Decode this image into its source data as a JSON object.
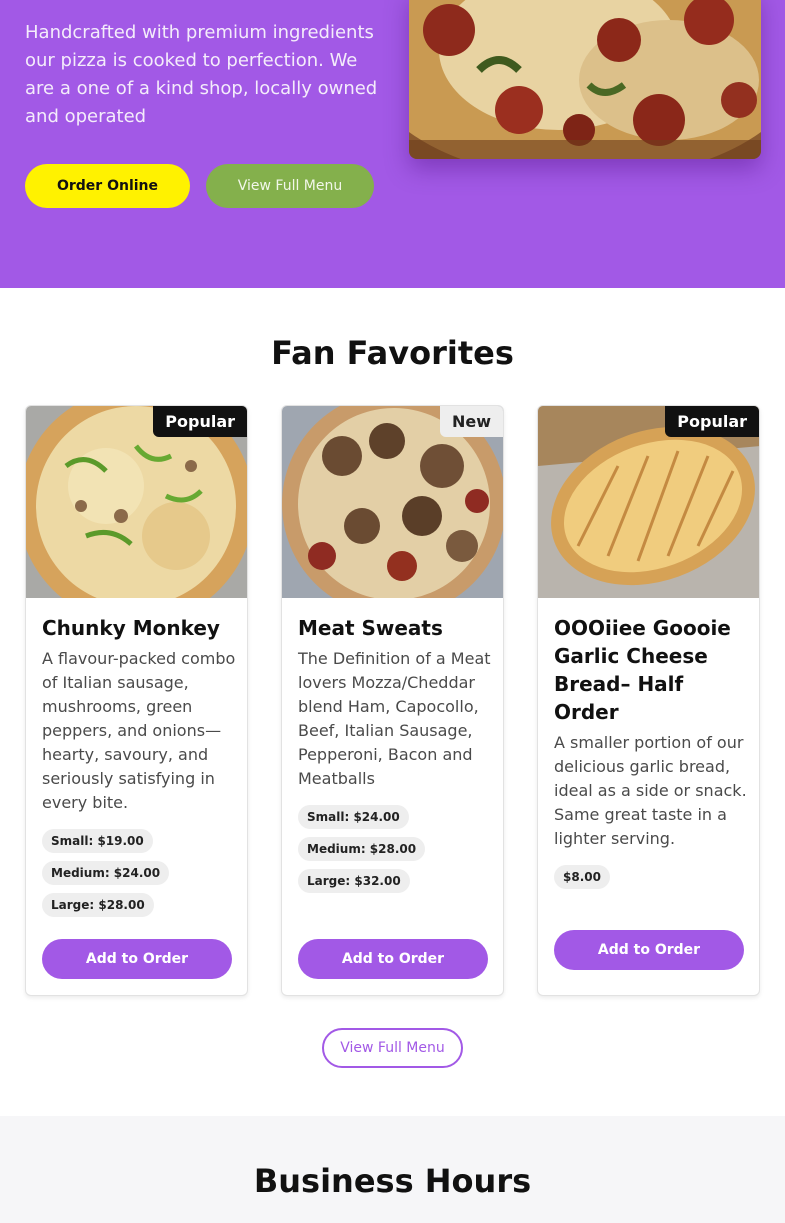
{
  "hero": {
    "text": "Handcrafted with premium ingredients our pizza is cooked to perfection. We are a one of a kind shop, locally owned and operated",
    "order_label": "Order Online",
    "menu_label": "View Full Menu"
  },
  "favorites": {
    "title": "Fan Favorites",
    "items": [
      {
        "badge": "Popular",
        "name": "Chunky Monkey",
        "description": "A flavour-packed combo of Italian sausage, mushrooms, green peppers, and onions—hearty, savoury, and seriously satisfying in every bite.",
        "prices": [
          "Small: $19.00",
          "Medium: $24.00",
          "Large: $28.00"
        ],
        "button": "Add to Order"
      },
      {
        "badge": "New",
        "name": "Meat Sweats",
        "description": "The Definition of a Meat lovers Mozza/Cheddar blend Ham, Capocollo, Beef, Italian Sausage, Pepperoni, Bacon and Meatballs",
        "prices": [
          "Small: $24.00",
          "Medium: $28.00",
          "Large: $32.00"
        ],
        "button": "Add to Order"
      },
      {
        "badge": "Popular",
        "name": "OOOiiee Goooie Garlic Cheese Bread– Half Order",
        "description": "A smaller portion of our delicious garlic bread, ideal as a side or snack. Same great taste in a lighter serving.",
        "prices": [
          "$8.00"
        ],
        "button": "Add to Order"
      }
    ],
    "view_full_label": "View Full Menu"
  },
  "hours": {
    "title": "Business Hours"
  },
  "colors": {
    "brand_purple": "#a259e6",
    "order_yellow": "#fff200",
    "menu_green": "#84b04c"
  }
}
